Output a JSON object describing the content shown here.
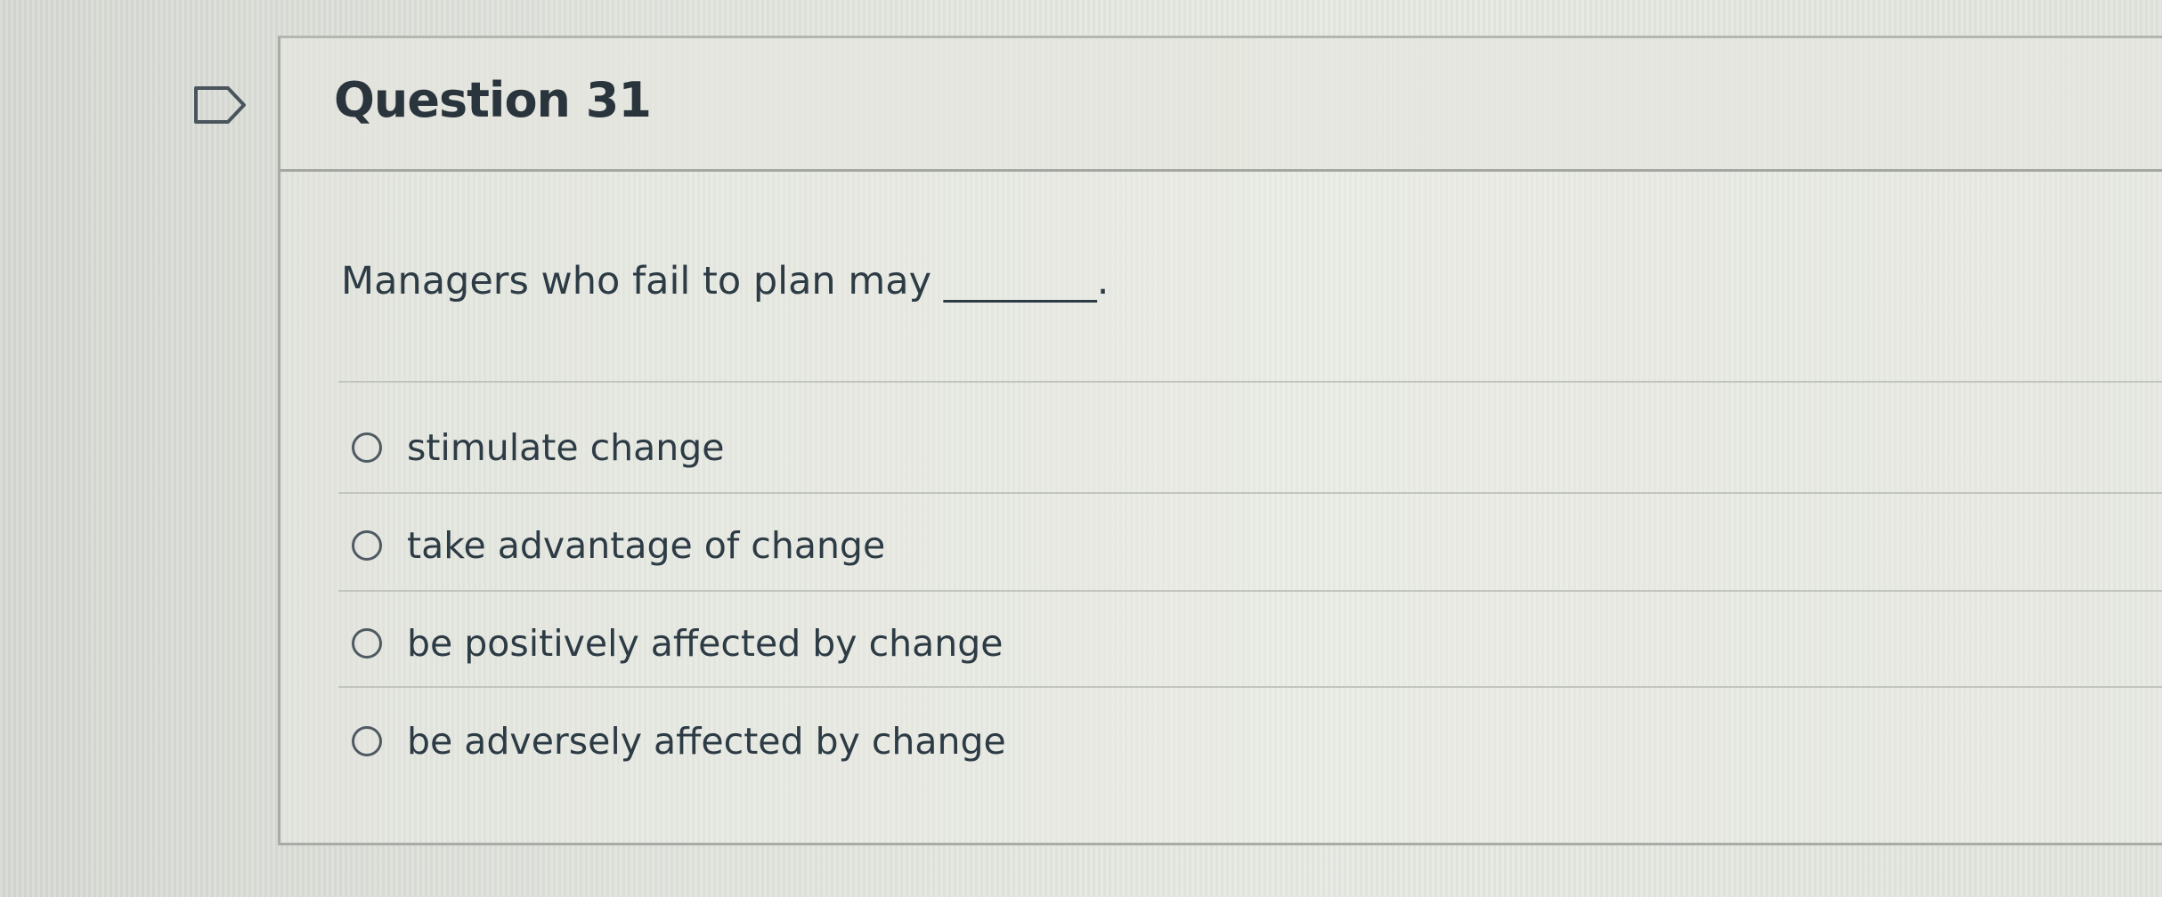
{
  "question": {
    "title": "Question 31",
    "prompt": "Managers who fail to plan may ________.",
    "answers": [
      {
        "label": "stimulate change",
        "selected": false
      },
      {
        "label": "take advantage of change",
        "selected": false
      },
      {
        "label": "be positively affected by change",
        "selected": false
      },
      {
        "label": "be adversely affected by change",
        "selected": false
      }
    ]
  },
  "icons": {
    "flag": "flag-question-icon",
    "radio": "radio-unselected-icon"
  },
  "colors": {
    "text": "#2d3b45",
    "border": "#a9aca6"
  }
}
